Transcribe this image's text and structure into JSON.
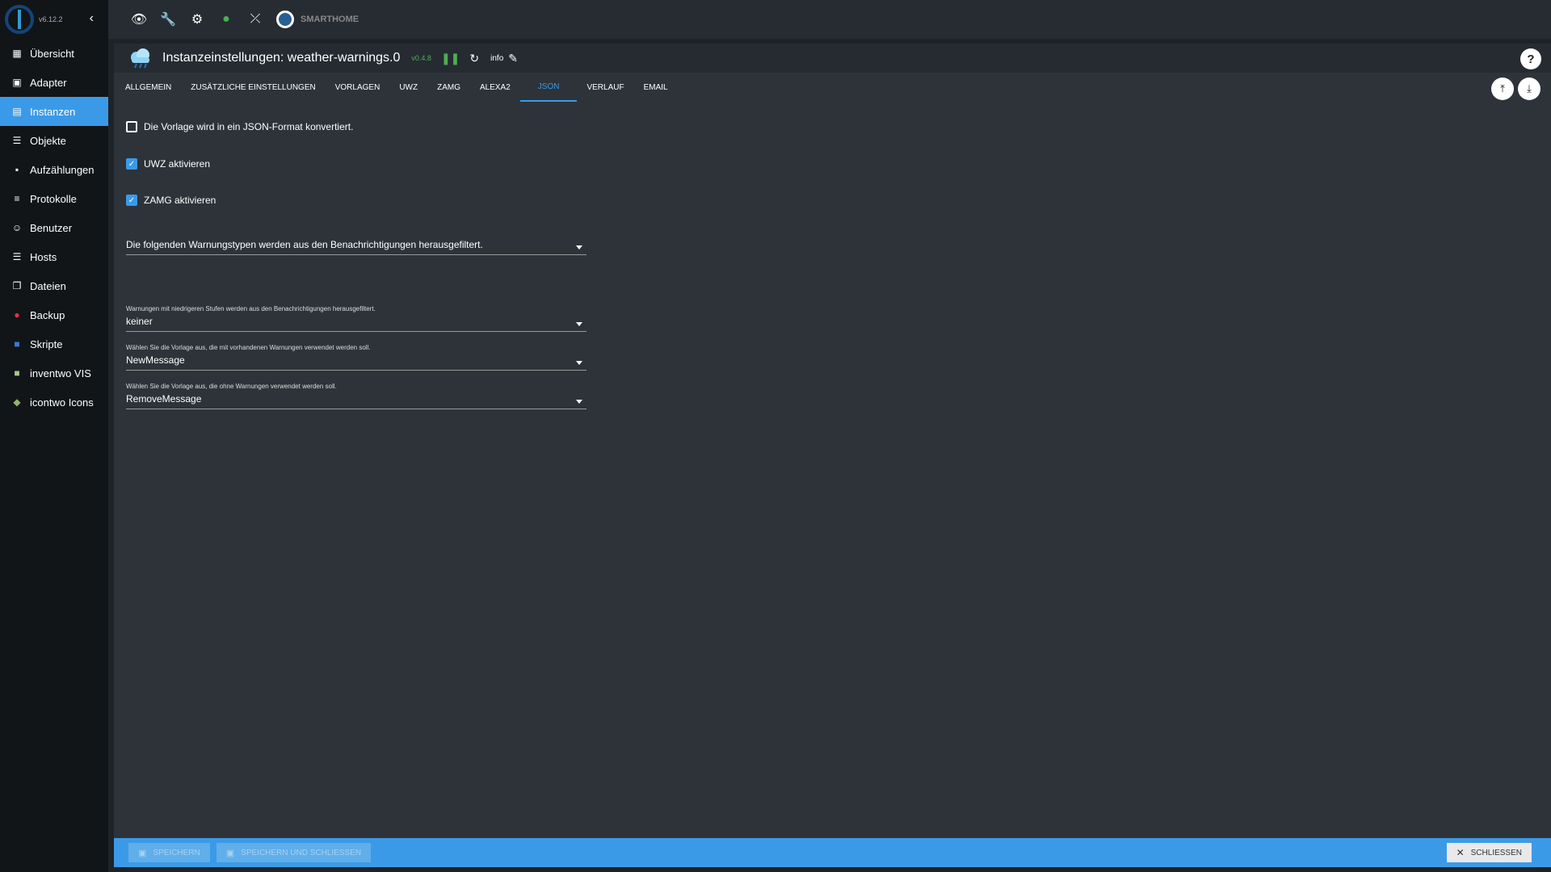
{
  "sidebar": {
    "version": "v6.12.2",
    "items": [
      {
        "label": "Übersicht",
        "icon": "grid-icon",
        "glyph": "▦"
      },
      {
        "label": "Adapter",
        "icon": "store-icon",
        "glyph": "▣"
      },
      {
        "label": "Instanzen",
        "icon": "instances-icon",
        "glyph": "▤"
      },
      {
        "label": "Objekte",
        "icon": "list-icon",
        "glyph": "☰"
      },
      {
        "label": "Aufzählungen",
        "icon": "enum-icon",
        "glyph": "▪"
      },
      {
        "label": "Protokolle",
        "icon": "log-icon",
        "glyph": "≡"
      },
      {
        "label": "Benutzer",
        "icon": "user-icon",
        "glyph": "☺"
      },
      {
        "label": "Hosts",
        "icon": "hosts-icon",
        "glyph": "☰"
      },
      {
        "label": "Dateien",
        "icon": "files-icon",
        "glyph": "❐"
      },
      {
        "label": "Backup",
        "icon": "backup-icon",
        "glyph": "●"
      },
      {
        "label": "Skripte",
        "icon": "scripts-icon",
        "glyph": "■"
      },
      {
        "label": "inventwo VIS",
        "icon": "inventwo-icon",
        "glyph": "■"
      },
      {
        "label": "icontwo Icons",
        "icon": "icontwo-icon",
        "glyph": "◆"
      }
    ]
  },
  "topbar": {
    "brand": "SMARTHOME"
  },
  "instance": {
    "title": "Instanzeinstellungen: weather-warnings.0",
    "version": "v0.4.8",
    "info": "info"
  },
  "tabs": [
    "ALLGEMEIN",
    "ZUSÄTZLICHE EINSTELLUNGEN",
    "VORLAGEN",
    "UWZ",
    "ZAMG",
    "ALEXA2",
    "JSON",
    "VERLAUF",
    "EMAIL"
  ],
  "form": {
    "json_format": {
      "label": "Die Vorlage wird in ein JSON-Format konvertiert.",
      "checked": false
    },
    "uwz_enable": {
      "label": "UWZ aktivieren",
      "checked": true
    },
    "zamg_enable": {
      "label": "ZAMG aktivieren",
      "checked": true
    },
    "filter_types": {
      "label": "",
      "value": "Die folgenden Warnungstypen werden aus den Benachrichtigungen herausgefiltert."
    },
    "filter_level": {
      "label": "Warnungen mit niedrigeren Stufen werden aus den Benachrichtigungen herausgefiltert.",
      "value": "keiner"
    },
    "template_with": {
      "label": "Wählen Sie die Vorlage aus, die mit vorhandenen Warnungen verwendet werden soll.",
      "value": "NewMessage"
    },
    "template_without": {
      "label": "Wählen Sie die Vorlage aus, die ohne Warnungen verwendet werden soll.",
      "value": "RemoveMessage"
    }
  },
  "footer": {
    "save": "SPEICHERN",
    "save_close": "SPEICHERN UND SCHLIESSEN",
    "close": "SCHLIESSEN"
  },
  "colors": {
    "accent": "#3b9ae7",
    "running": "#4caf50"
  }
}
